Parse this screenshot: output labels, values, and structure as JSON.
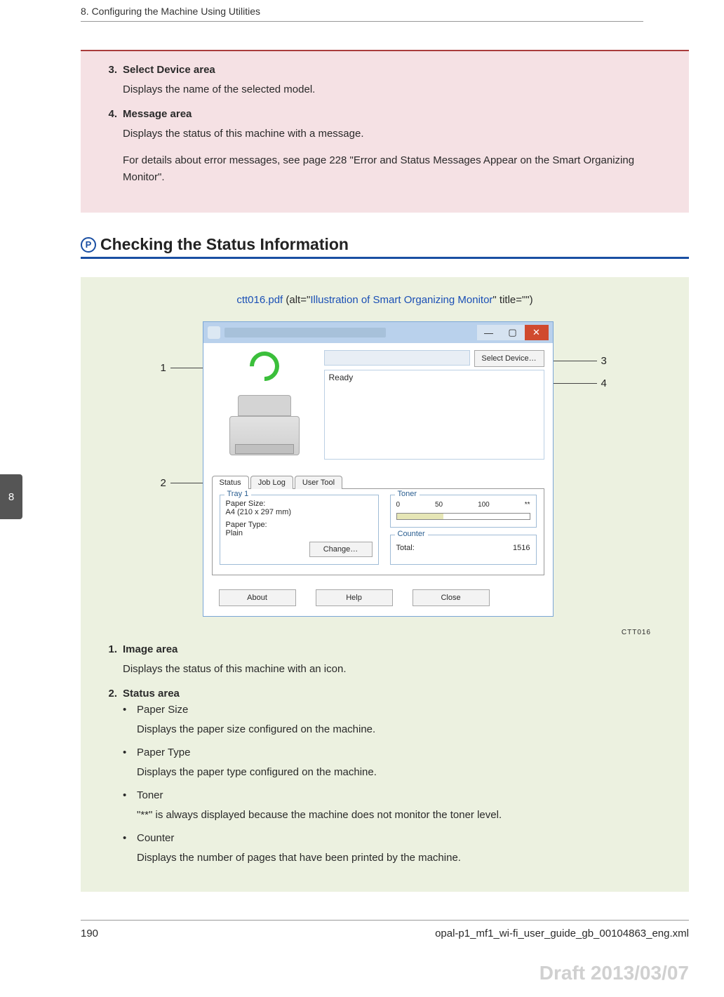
{
  "header": {
    "chapter_title": "8. Configuring the Machine Using Utilities"
  },
  "chapter_tab": "8",
  "pink_box": {
    "items": [
      {
        "num": "3.",
        "title": "Select Device area",
        "body": [
          "Displays the name of the selected model."
        ]
      },
      {
        "num": "4.",
        "title": "Message area",
        "body": [
          "Displays the status of this machine with a message.",
          "For details about error messages, see page 228 \"Error and Status Messages Appear on the Smart Organizing Monitor\"."
        ]
      }
    ]
  },
  "section": {
    "badge": "P",
    "title": "Checking the Status Information"
  },
  "figure": {
    "link_text": "ctt016.pdf",
    "alt_prefix": " (alt=\"",
    "alt_text": "Illustration of Smart Organizing Monitor",
    "alt_suffix": "\" title=\"\")",
    "code": "CTT016",
    "callouts": {
      "one": "1",
      "two": "2",
      "three": "3",
      "four": "4"
    },
    "window": {
      "select_device": "Select Device…",
      "ready": "Ready",
      "tabs": {
        "status": "Status",
        "joblog": "Job Log",
        "usertool": "User Tool"
      },
      "tray": {
        "legend": "Tray 1",
        "paper_size_label": "Paper Size:",
        "paper_size": "A4 (210 x 297 mm)",
        "paper_type_label": "Paper Type:",
        "paper_type": "Plain",
        "change": "Change…"
      },
      "toner": {
        "legend": "Toner",
        "scale0": "0",
        "scale50": "50",
        "scale100": "100",
        "stars": "**"
      },
      "counter": {
        "legend": "Counter",
        "total_label": "Total:",
        "total": "1516"
      },
      "buttons": {
        "about": "About",
        "help": "Help",
        "close": "Close"
      },
      "win_btns": {
        "min": "—",
        "max": "▢",
        "close": "✕"
      }
    }
  },
  "green_list": {
    "items": [
      {
        "num": "1.",
        "title": "Image area",
        "body": [
          "Displays the status of this machine with an icon."
        ],
        "sub": []
      },
      {
        "num": "2.",
        "title": "Status area",
        "body": [],
        "sub": [
          {
            "title": "Paper Size",
            "body": "Displays the paper size configured on the machine."
          },
          {
            "title": "Paper Type",
            "body": "Displays the paper type configured on the machine."
          },
          {
            "title": "Toner",
            "body": "\"**\" is always displayed because the machine does not monitor the toner level."
          },
          {
            "title": "Counter",
            "body": "Displays the number of pages that have been printed by the machine."
          }
        ]
      }
    ]
  },
  "footer": {
    "page": "190",
    "file": "opal-p1_mf1_wi-fi_user_guide_gb_00104863_eng.xml"
  },
  "draft": "Draft 2013/03/07"
}
